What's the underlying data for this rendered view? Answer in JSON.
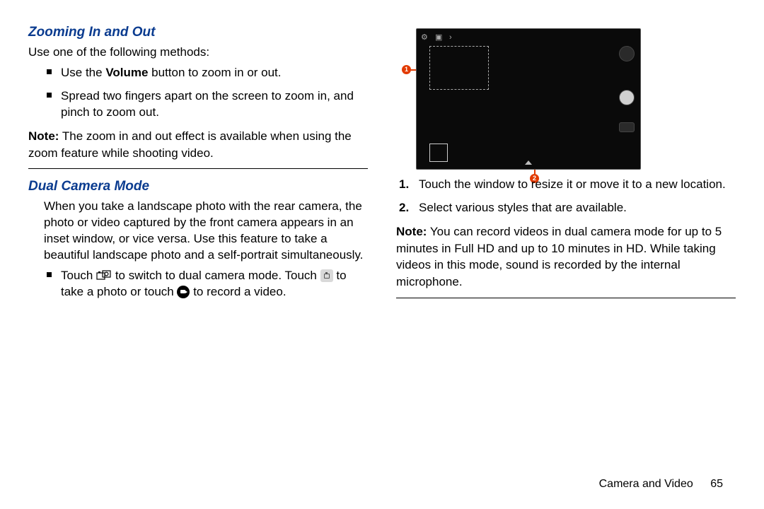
{
  "left": {
    "heading1": "Zooming In and Out",
    "intro1": "Use one of the following methods:",
    "bullets1": [
      {
        "pre": "Use the ",
        "bold": "Volume",
        "post": " button to zoom in or out."
      },
      {
        "text": "Spread two fingers apart on the screen to zoom in, and pinch to zoom out."
      }
    ],
    "note1_label": "Note:",
    "note1_body": " The zoom in and out effect is available when using the zoom feature while shooting video.",
    "heading2": "Dual Camera Mode",
    "para2": "When you take a landscape photo with the rear camera, the photo or video captured by the front camera appears in an inset window, or vice versa. Use this feature to take a beautiful landscape photo and a self-portrait simultaneously.",
    "bullet2_a": "Touch ",
    "bullet2_b": " to switch to dual camera mode. Touch ",
    "bullet2_c": " to take a photo or touch ",
    "bullet2_d": " to record a video."
  },
  "right": {
    "callouts": {
      "c1": "1",
      "c2": "2"
    },
    "steps": [
      "Touch the window to resize it or move it to a new location.",
      "Select various styles that are available."
    ],
    "step_nums": [
      "1.",
      "2."
    ],
    "note2_label": "Note:",
    "note2_body": " You can record videos in dual camera mode for up to 5 minutes in Full HD and up to 10 minutes in HD. While taking videos in this mode, sound is recorded by the internal microphone."
  },
  "footer": {
    "chapter": "Camera and Video",
    "page": "65"
  }
}
